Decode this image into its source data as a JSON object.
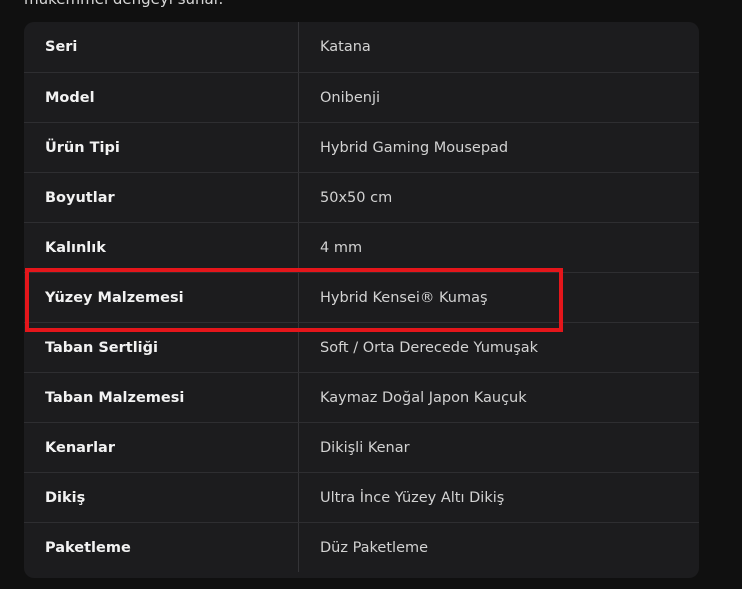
{
  "intro": {
    "text": "mükemmel dengeyi sunar."
  },
  "specs": {
    "rows": [
      {
        "label": "Seri",
        "value": "Katana"
      },
      {
        "label": "Model",
        "value": "Onibenji"
      },
      {
        "label": "Ürün Tipi",
        "value": "Hybrid Gaming Mousepad"
      },
      {
        "label": "Boyutlar",
        "value": "50x50 cm"
      },
      {
        "label": "Kalınlık",
        "value": "4 mm"
      },
      {
        "label": "Yüzey Malzemesi",
        "value": "Hybrid Kensei® Kumaş"
      },
      {
        "label": "Taban Sertliği",
        "value": "Soft / Orta Derecede Yumuşak"
      },
      {
        "label": "Taban Malzemesi",
        "value": "Kaymaz Doğal Japon Kauçuk"
      },
      {
        "label": "Kenarlar",
        "value": "Dikişli Kenar"
      },
      {
        "label": "Dikiş",
        "value": "Ultra İnce Yüzey Altı Dikiş"
      },
      {
        "label": "Paketleme",
        "value": "Düz Paketleme"
      }
    ]
  },
  "colors": {
    "background": "#101010",
    "card": "#1c1c1e",
    "highlight": "#e4161b"
  }
}
